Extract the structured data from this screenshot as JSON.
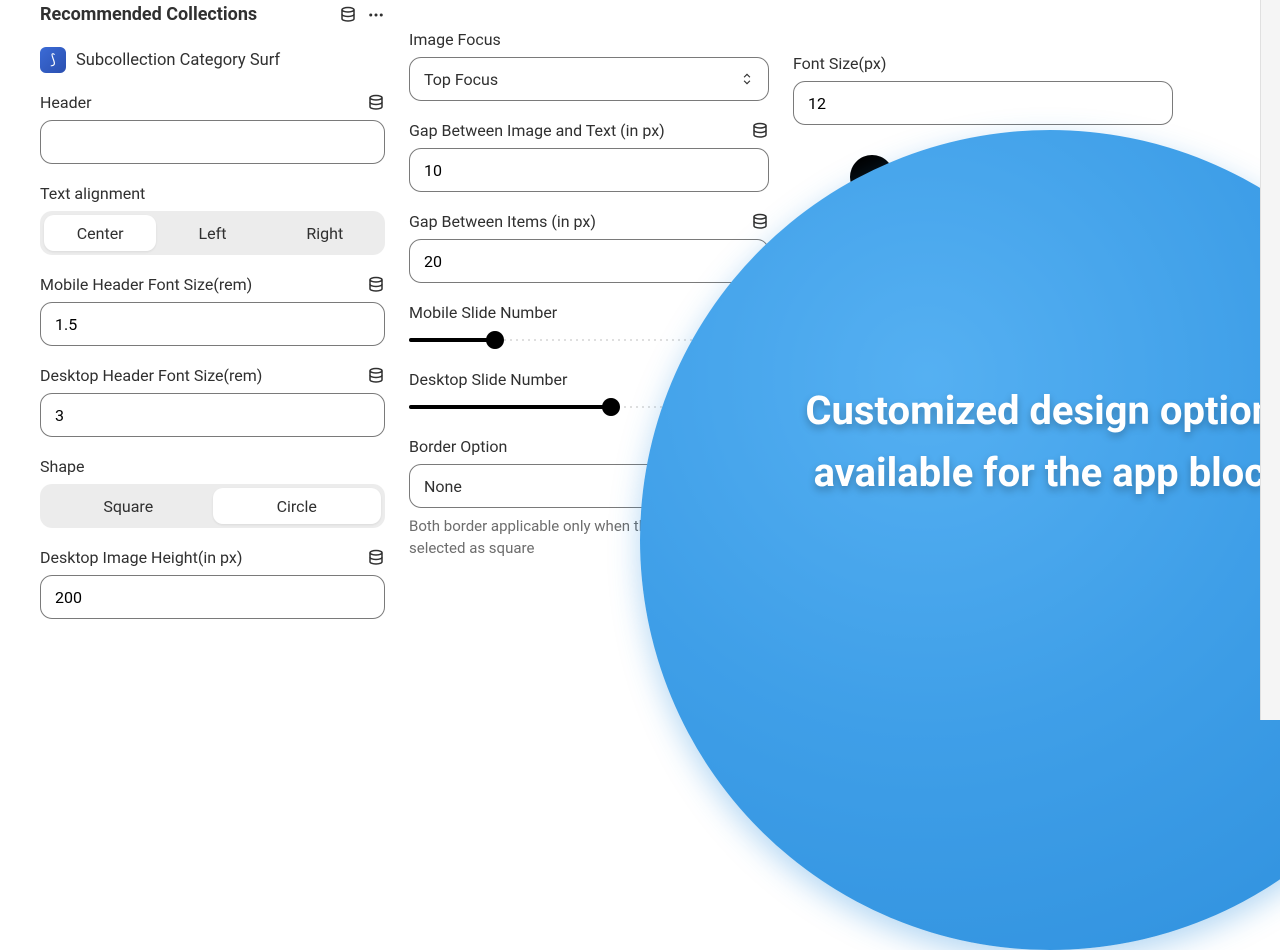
{
  "panel": {
    "title": "Recommended Collections",
    "subcollection": "Subcollection Category Surf"
  },
  "col1": {
    "header_label": "Header",
    "header_value": "",
    "text_alignment_label": "Text alignment",
    "alignment_options": {
      "center": "Center",
      "left": "Left",
      "right": "Right"
    },
    "mobile_header_font_label": "Mobile Header Font Size(rem)",
    "mobile_header_font_value": "1.5",
    "desktop_header_font_label": "Desktop Header Font Size(rem)",
    "desktop_header_font_value": "3",
    "shape_label": "Shape",
    "shape_options": {
      "square": "Square",
      "circle": "Circle"
    },
    "desktop_image_height_label": "Desktop Image Height(in px)",
    "desktop_image_height_value": "200"
  },
  "col2": {
    "image_focus_label": "Image Focus",
    "image_focus_value": "Top Focus",
    "gap_image_text_label": "Gap Between Image and Text (in px)",
    "gap_image_text_value": "10",
    "gap_items_label": "Gap Between Items (in px)",
    "gap_items_value": "20",
    "mobile_slide_label": "Mobile Slide Number",
    "mobile_slide_percent": 24,
    "desktop_slide_label": "Desktop Slide Number",
    "desktop_slide_percent": 56,
    "border_option_label": "Border Option",
    "border_option_value": "None",
    "border_helper": "Both border applicable only when the shape is selected as square"
  },
  "col3": {
    "font_size_label": "Font Size(px)",
    "font_size_value": "12"
  },
  "overlay": {
    "text": "Customized design options available for the app block"
  }
}
